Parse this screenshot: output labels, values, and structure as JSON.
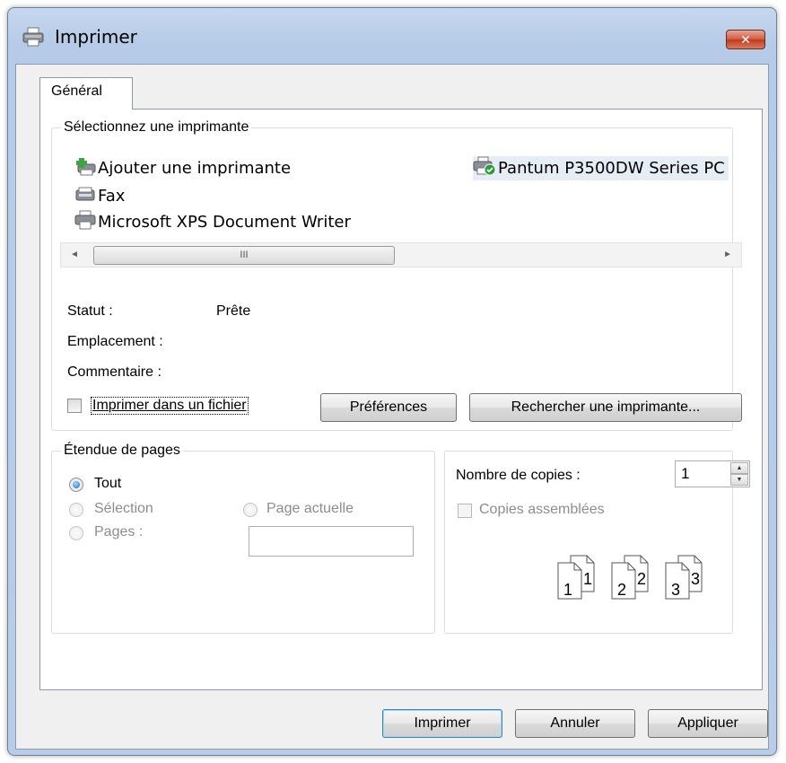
{
  "window": {
    "title": "Imprimer",
    "close_label": "✕"
  },
  "tabs": [
    {
      "label": "Général"
    }
  ],
  "printer_group": {
    "legend": "Sélectionnez une imprimante",
    "printers": [
      {
        "name": "Ajouter une imprimante",
        "icon": "add-printer-icon"
      },
      {
        "name": "Pantum P3500DW Series PC",
        "icon": "default-printer-icon",
        "selected": true
      },
      {
        "name": "Fax",
        "icon": "fax-icon"
      },
      {
        "name": "Microsoft XPS Document Writer",
        "icon": "printer-icon"
      }
    ],
    "scrollbar": {
      "left": "◄",
      "right": "►",
      "grip": "III"
    },
    "status_label": "Statut :",
    "status_value": "Prête",
    "location_label": "Emplacement :",
    "location_value": "",
    "comment_label": "Commentaire :",
    "comment_value": "",
    "print_to_file_label": "Imprimer dans un fichier",
    "print_to_file_checked": false,
    "preferences_button": "Préférences",
    "find_printer_button": "Rechercher une imprimante..."
  },
  "page_range_group": {
    "legend": "Étendue de pages",
    "all_label": "Tout",
    "selection_label": "Sélection",
    "current_page_label": "Page actuelle",
    "pages_label": "Pages :",
    "pages_value": "",
    "selected": "Tout"
  },
  "copies_group": {
    "copies_label": "Nombre de copies :",
    "copies_value": "1",
    "spin_up": "▲",
    "spin_down": "▼",
    "collate_label": "Copies assemblées",
    "collate_checked": false,
    "collate_pages": [
      "1",
      "1",
      "2",
      "2",
      "3",
      "3"
    ]
  },
  "footer": {
    "print_button": "Imprimer",
    "cancel_button": "Annuler",
    "apply_button": "Appliquer"
  },
  "colors": {
    "frame": "#b9cde8",
    "close_button": "#c0391d",
    "client": "#f0f0f0",
    "default_button_border": "#3c7fb1"
  }
}
